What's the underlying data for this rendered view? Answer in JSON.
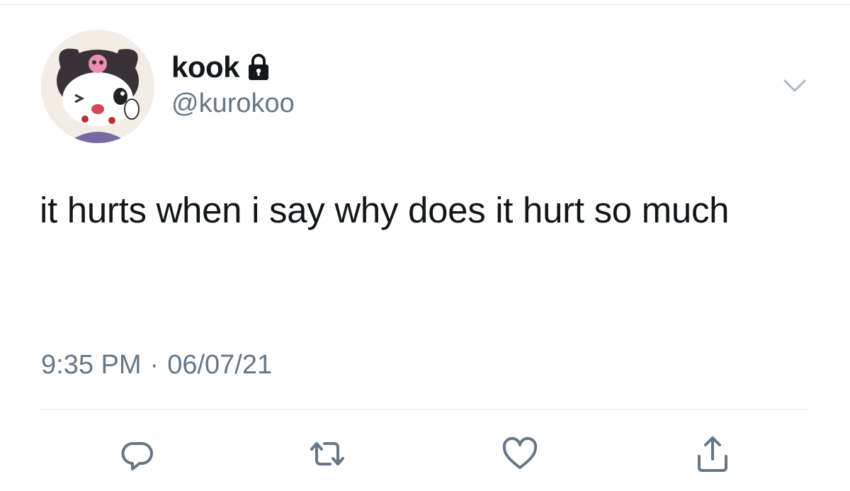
{
  "tweet": {
    "display_name": "kook",
    "handle": "@kurokoo",
    "text": "it hurts when i say why does it hurt so much",
    "time": "9:35 PM",
    "separator": "·",
    "date": "06/07/21",
    "protected": true
  },
  "icons": {
    "lock": "lock-icon",
    "more": "chevron-down-icon",
    "reply": "reply-icon",
    "retweet": "retweet-icon",
    "like": "heart-icon",
    "share": "share-icon"
  },
  "colors": {
    "text_primary": "#14171a",
    "text_secondary": "#657786",
    "icon_gray": "#657786",
    "chevron": "#aab8c2",
    "divider": "#e1e8ed"
  }
}
